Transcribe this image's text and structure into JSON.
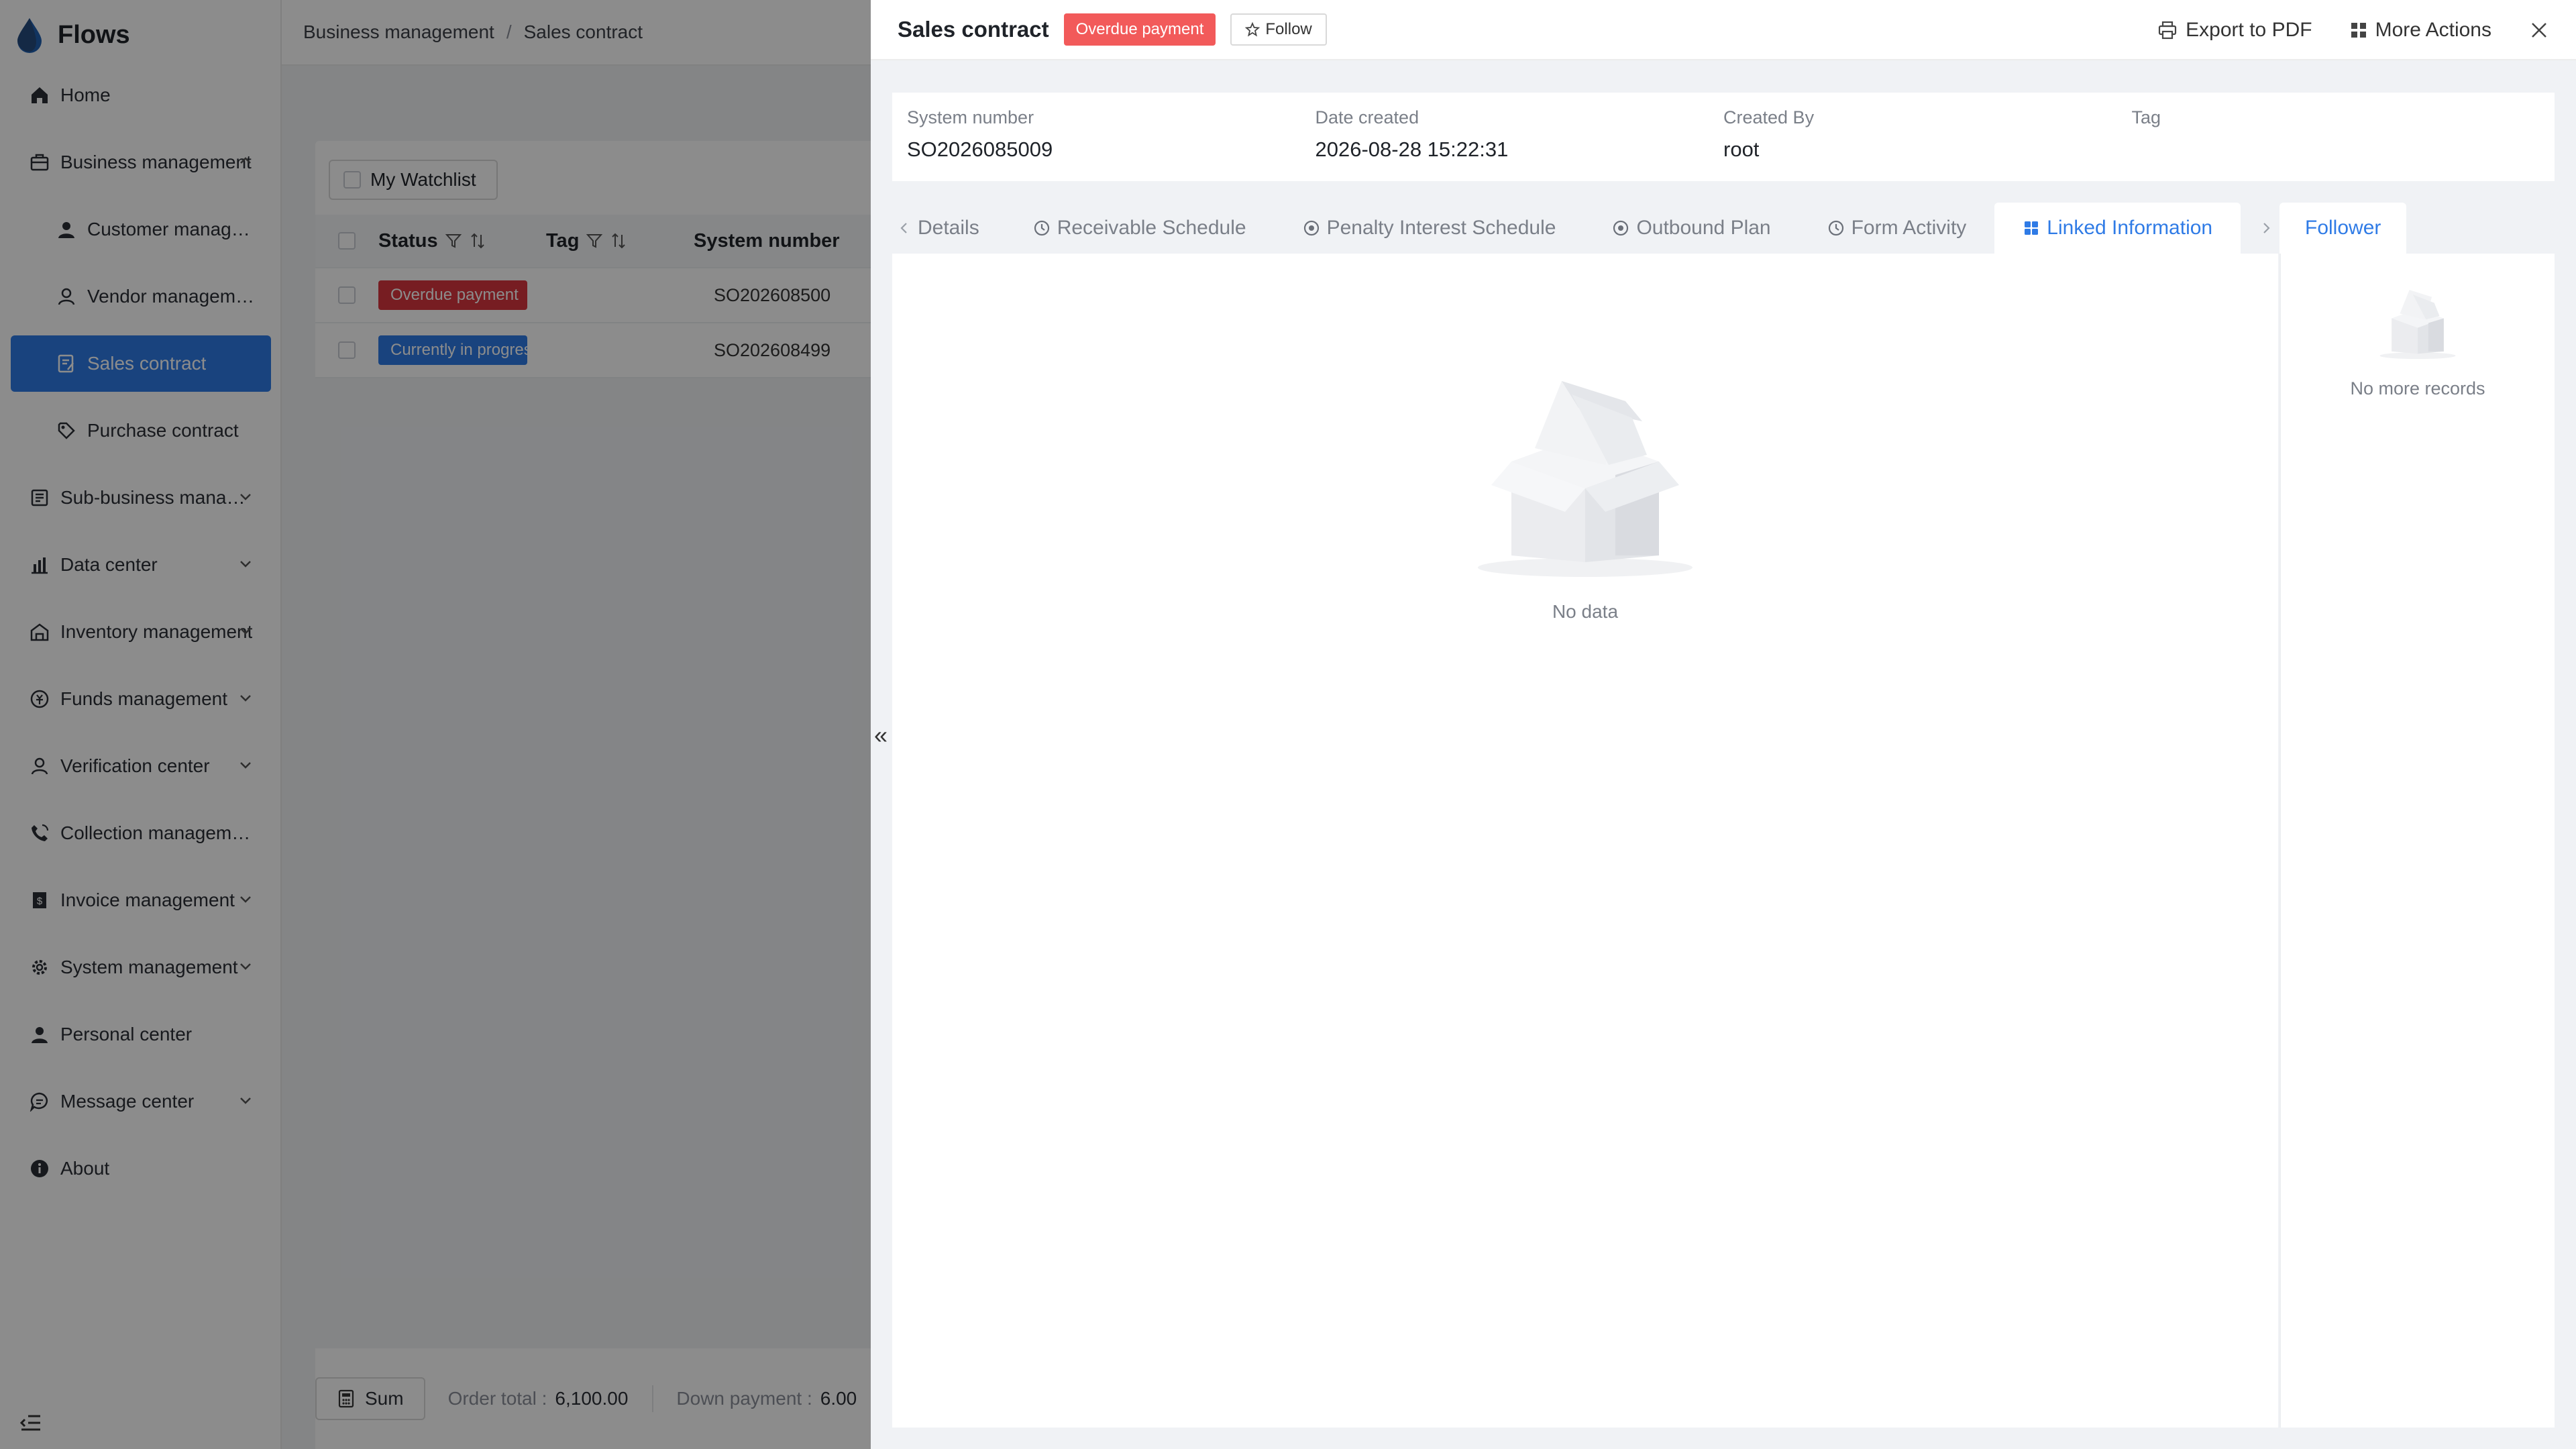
{
  "app": {
    "name": "Flows"
  },
  "sidebar": {
    "items": [
      {
        "label": "Home",
        "icon": "home-icon"
      },
      {
        "label": "Business management",
        "icon": "briefcase-icon",
        "expanded": true
      },
      {
        "label": "Customer management",
        "icon": "user-icon"
      },
      {
        "label": "Vendor management",
        "icon": "vendor-user-icon"
      },
      {
        "label": "Sales contract",
        "icon": "contract-icon",
        "active": true
      },
      {
        "label": "Purchase contract",
        "icon": "purchase-tag-icon"
      },
      {
        "label": "Sub-business management",
        "icon": "sub-business-icon"
      },
      {
        "label": "Data center",
        "icon": "bar-chart-icon"
      },
      {
        "label": "Inventory management",
        "icon": "warehouse-icon"
      },
      {
        "label": "Funds management",
        "icon": "funds-icon"
      },
      {
        "label": "Verification center",
        "icon": "verification-user-icon"
      },
      {
        "label": "Collection management",
        "icon": "phone-icon"
      },
      {
        "label": "Invoice management",
        "icon": "invoice-icon"
      },
      {
        "label": "System management",
        "icon": "gear-icon"
      },
      {
        "label": "Personal center",
        "icon": "person-icon"
      },
      {
        "label": "Message center",
        "icon": "message-icon"
      },
      {
        "label": "About",
        "icon": "info-icon"
      }
    ]
  },
  "breadcrumb": {
    "parent": "Business management",
    "sep": "/",
    "current": "Sales contract"
  },
  "list": {
    "watchlist_label": "My Watchlist",
    "columns": {
      "status": "Status",
      "tag": "Tag",
      "system_number": "System number"
    },
    "rows": [
      {
        "status": "Overdue payment",
        "status_color": "#d9363e",
        "system_number": "SO202608500"
      },
      {
        "status": "Currently in progress",
        "status_color": "#2f7be6",
        "system_number": "SO202608499"
      }
    ],
    "footer": {
      "sum_label": "Sum",
      "order_total_label": "Order total :",
      "order_total_value": "6,100.00",
      "down_payment_label": "Down payment :",
      "down_payment_value": "6.00"
    }
  },
  "drawer": {
    "title": "Sales contract",
    "status_badge": "Overdue payment",
    "follow_label": "Follow",
    "export_label": "Export to PDF",
    "more_actions_label": "More Actions",
    "info": [
      {
        "label": "System number",
        "value": "SO2026085009"
      },
      {
        "label": "Date created",
        "value": "2026-08-28 15:22:31"
      },
      {
        "label": "Created By",
        "value": "root"
      },
      {
        "label": "Tag",
        "value": ""
      }
    ],
    "tabs": [
      {
        "label": "Details",
        "icon": ""
      },
      {
        "label": "Receivable Schedule",
        "icon": "clock-icon"
      },
      {
        "label": "Penalty Interest Schedule",
        "icon": "coin-icon"
      },
      {
        "label": "Outbound Plan",
        "icon": "coin-icon"
      },
      {
        "label": "Form Activity",
        "icon": "clock-icon"
      },
      {
        "label": "Linked Information",
        "icon": "grid-icon",
        "active": true
      }
    ],
    "empty_text": "No data",
    "follower_tab": "Follower",
    "follower_empty": "No more records",
    "collapse_glyph": "«"
  },
  "colors": {
    "accent": "#2f7be6",
    "danger": "#f25a5a",
    "overlay": "rgba(0,0,0,0.45)"
  }
}
